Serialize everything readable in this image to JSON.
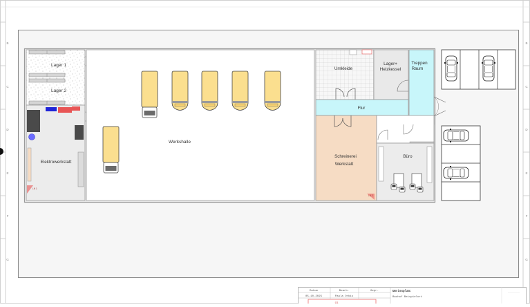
{
  "rooms": {
    "lager1": "Lager 1",
    "lager2": "Lager 2",
    "elektro": "Elektrowerkstatt",
    "werkhalle": "Werkshalle",
    "umkleide": "Umkleide",
    "heiz_l1": "Lager+",
    "heiz_l2": "Heizkessel",
    "treppen_l1": "Treppen",
    "treppen_l2": "Raum",
    "flur": "Flur",
    "schreinerei_l1": "Schreinerei",
    "schreinerei_l2": "Werkstatt",
    "buero": "Büro"
  },
  "markers": {
    "a": "LN 1",
    "b": "LN 2",
    "c": "LN 2"
  },
  "border": {
    "left": [
      "B",
      "C",
      "D",
      "E",
      "F",
      "G"
    ],
    "right": [
      "B",
      "C",
      "D",
      "E",
      "F",
      "G"
    ]
  },
  "title_block": {
    "h_datum": "Datum",
    "h_bearb": "Bearb.",
    "h_gepr": "Gepr.",
    "v_datum": "05.10.2025",
    "v_bearb": "Paula Orbis",
    "title_label": "Umrissplan:",
    "title_value": "Bauhof Beispielort",
    "stamp": "CS"
  },
  "colors": {
    "truck": "#fbdf8f",
    "flur": "#c8f6fa",
    "schreinerei": "#f6dcc4",
    "room_gray": "#ececec"
  }
}
